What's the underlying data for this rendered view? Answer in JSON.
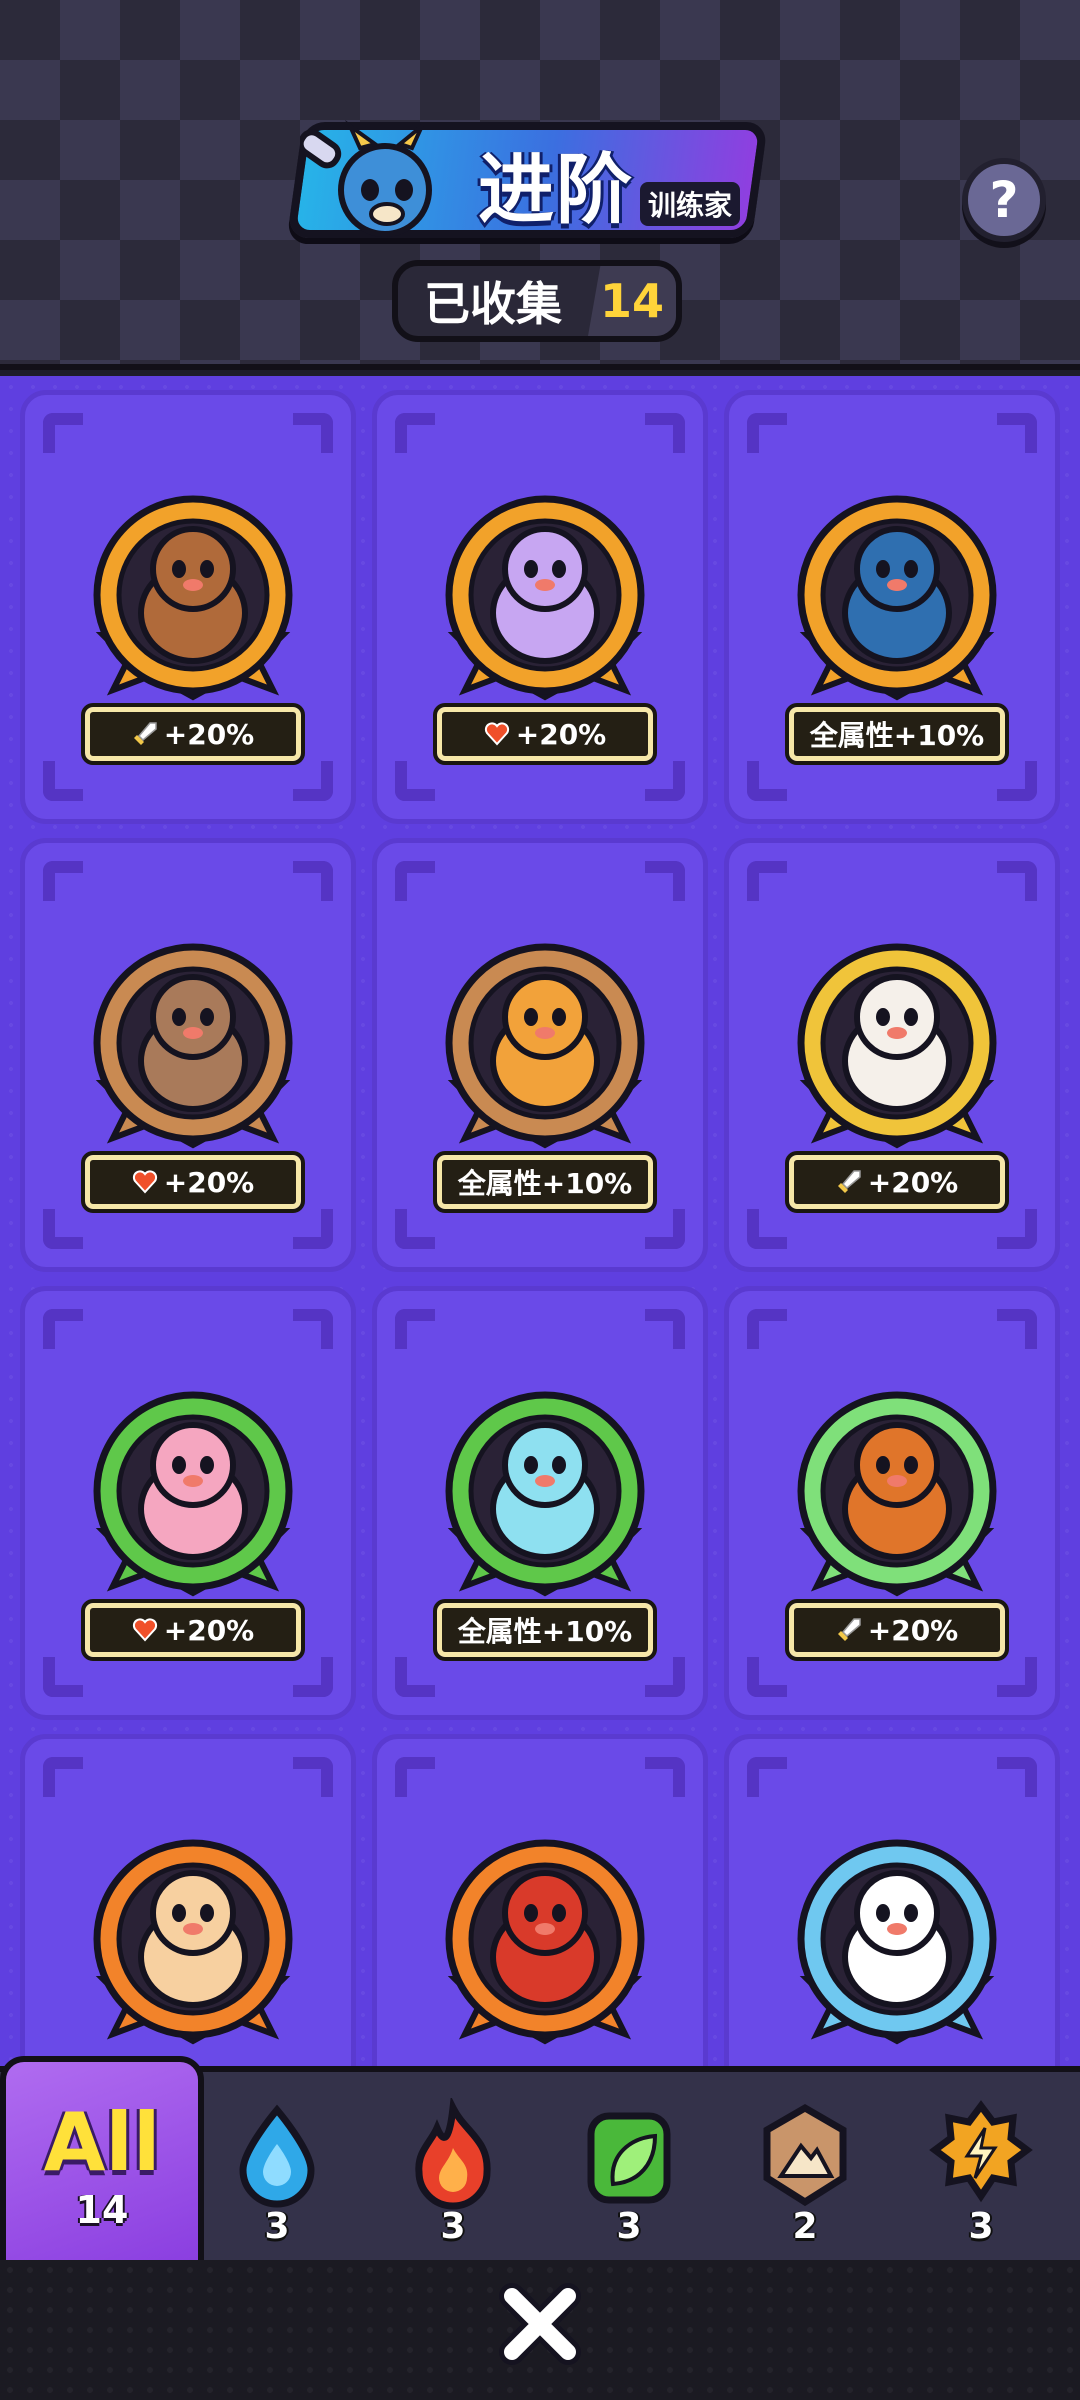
{
  "header": {
    "title": "进阶",
    "subtitle": "训练家",
    "help_label": "?",
    "collected_label": "已收集",
    "collected_count": "14"
  },
  "cards": [
    {
      "name": "antler-deer",
      "element": "electric",
      "bonus_icon": "sword-icon",
      "bonus": "+20%",
      "ring": "#f2a22a",
      "body": "#b06a3a"
    },
    {
      "name": "purple-cat",
      "element": "fire",
      "bonus_icon": "heart-icon",
      "bonus": "+20%",
      "ring": "#f2a22a",
      "body": "#c7a6f2"
    },
    {
      "name": "toucan",
      "element": "fire",
      "bonus_icon": "",
      "bonus": "全属性+10%",
      "ring": "#f2a22a",
      "body": "#2f6fb0"
    },
    {
      "name": "rock-monkey",
      "element": "earth",
      "bonus_icon": "heart-icon",
      "bonus": "+20%",
      "ring": "#c98a52",
      "body": "#a97a5a"
    },
    {
      "name": "slime-bunny",
      "element": "earth",
      "bonus_icon": "",
      "bonus": "全属性+10%",
      "ring": "#c98a52",
      "body": "#f2a23a"
    },
    {
      "name": "flower-panda",
      "element": "grass",
      "bonus_icon": "sword-icon",
      "bonus": "+20%",
      "ring": "#f0c43a",
      "body": "#f5f0ea"
    },
    {
      "name": "leaf-fairy",
      "element": "grass",
      "bonus_icon": "heart-icon",
      "bonus": "+20%",
      "ring": "#5fc84a",
      "body": "#f5a6c0"
    },
    {
      "name": "potion-sprout",
      "element": "grass",
      "bonus_icon": "",
      "bonus": "全属性+10%",
      "ring": "#5fc84a",
      "body": "#8ee0f0"
    },
    {
      "name": "flame-tiger",
      "element": "grass",
      "bonus_icon": "sword-icon",
      "bonus": "+20%",
      "ring": "#7fe07a",
      "body": "#e0752a"
    },
    {
      "name": "fire-bunny",
      "element": "fire",
      "bonus_icon": "",
      "bonus": "",
      "ring": "#f2832a",
      "body": "#f7d0a0"
    },
    {
      "name": "fire-bird",
      "element": "fire",
      "bonus_icon": "",
      "bonus": "",
      "ring": "#f2832a",
      "body": "#d93a2a"
    },
    {
      "name": "water-fox",
      "element": "water",
      "bonus_icon": "",
      "bonus": "",
      "ring": "#6fc8f0",
      "body": "#ffffff"
    }
  ],
  "filter": {
    "all_label": "All",
    "all_count": "14",
    "elements": [
      {
        "name": "water",
        "icon": "water-drop-icon",
        "count": "3",
        "color": "#2fa8e8"
      },
      {
        "name": "fire",
        "icon": "flame-icon",
        "count": "3",
        "color": "#e8402a"
      },
      {
        "name": "grass",
        "icon": "leaf-icon",
        "count": "3",
        "color": "#4ab83a"
      },
      {
        "name": "earth",
        "icon": "mountain-icon",
        "count": "2",
        "color": "#c9956a"
      },
      {
        "name": "electric",
        "icon": "lightning-icon",
        "count": "3",
        "color": "#f2a422"
      }
    ]
  },
  "close_label": "×"
}
